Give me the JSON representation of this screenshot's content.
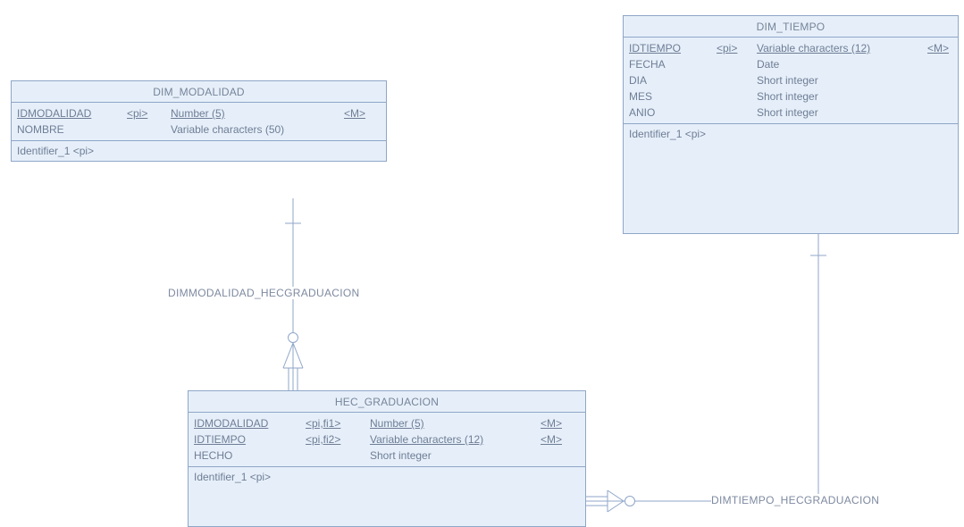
{
  "entities": {
    "dim_modalidad": {
      "title": "DIM_MODALIDAD",
      "attributes": [
        {
          "name": "IDMODALIDAD",
          "key": "<pi>",
          "type": "Number (5)",
          "mandatory": "<M>"
        },
        {
          "name": "NOMBRE",
          "key": "",
          "type": "Variable characters (50)",
          "mandatory": ""
        }
      ],
      "identifier": "Identifier_1  <pi>"
    },
    "dim_tiempo": {
      "title": "DIM_TIEMPO",
      "attributes": [
        {
          "name": "IDTIEMPO",
          "key": "<pi>",
          "type": "Variable characters (12)",
          "mandatory": "<M>"
        },
        {
          "name": "FECHA",
          "key": "",
          "type": "Date",
          "mandatory": ""
        },
        {
          "name": "DIA",
          "key": "",
          "type": "Short integer",
          "mandatory": ""
        },
        {
          "name": "MES",
          "key": "",
          "type": "Short integer",
          "mandatory": ""
        },
        {
          "name": "ANIO",
          "key": "",
          "type": "Short integer",
          "mandatory": ""
        }
      ],
      "identifier": "Identifier_1  <pi>"
    },
    "hec_graduacion": {
      "title": "HEC_GRADUACION",
      "attributes": [
        {
          "name": "IDMODALIDAD",
          "key": "<pi,fi1>",
          "type": "Number (5)",
          "mandatory": "<M>"
        },
        {
          "name": "IDTIEMPO",
          "key": "<pi,fi2>",
          "type": "Variable characters (12)",
          "mandatory": "<M>"
        },
        {
          "name": "HECHO",
          "key": "",
          "type": "Short integer",
          "mandatory": ""
        }
      ],
      "identifier": "Identifier_1  <pi>"
    }
  },
  "relationships": {
    "modalidad": "DIMMODALIDAD_HECGRADUACION",
    "tiempo": "DIMTIEMPO_HECGRADUACION"
  },
  "colors": {
    "entity_fill": "#e6eff9",
    "border": "#8fa6c8",
    "text": "#6e7d96"
  }
}
